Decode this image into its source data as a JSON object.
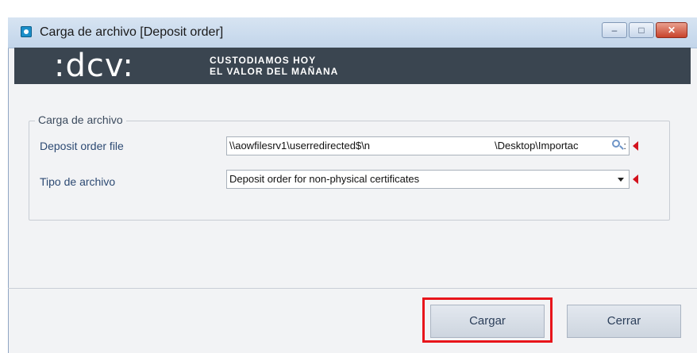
{
  "window": {
    "title": "Carga de archivo [Deposit order]",
    "app_icon": "app-logo-icon",
    "controls": {
      "minimize": "–",
      "maximize": "□",
      "close": "✕"
    }
  },
  "banner": {
    "logo_text": ":dcv:",
    "tagline_line1": "CUSTODIAMOS HOY",
    "tagline_line2": "EL VALOR DEL MAÑANA",
    "background": "#3a4550"
  },
  "form": {
    "group_label": "Carga de archivo",
    "deposit_file": {
      "label": "Deposit order file",
      "value_left": "\\\\aowfilesrv1\\userredirected$\\n",
      "value_right": "\\Desktop\\Importac"
    },
    "file_type": {
      "label": "Tipo de archivo",
      "selected": "Deposit order for non-physical certificates"
    }
  },
  "buttons": {
    "load": "Cargar",
    "close": "Cerrar"
  },
  "colors": {
    "required_marker": "#d3121d",
    "highlight": "#e8151b",
    "label_text": "#2d4a73"
  }
}
